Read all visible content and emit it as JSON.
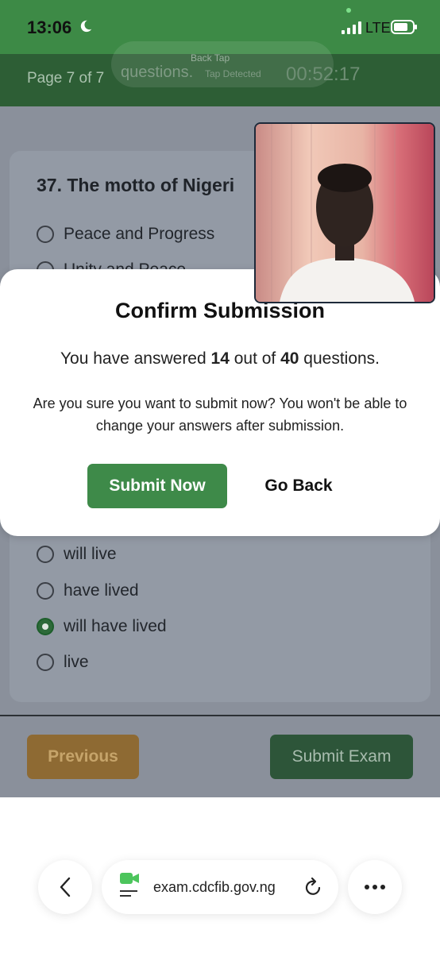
{
  "status_bar": {
    "time": "13:06",
    "network": "LTE"
  },
  "header": {
    "page_indicator": "Page 7 of 7",
    "timer": "00:52:17",
    "ghost_text": "questions.",
    "ghost_back_tap": "Back Tap",
    "ghost_sub": "Tap Detected"
  },
  "question": {
    "text": "37. The motto of Nigeri",
    "options_top": [
      "Peace and Progress",
      "Unity and Peace"
    ],
    "options_bottom": [
      {
        "label": "will live",
        "selected": false
      },
      {
        "label": "have lived",
        "selected": false
      },
      {
        "label": "will have lived",
        "selected": true
      },
      {
        "label": "live",
        "selected": false
      }
    ]
  },
  "footer": {
    "previous_label": "Previous",
    "submit_exam_label": "Submit Exam"
  },
  "modal": {
    "title": "Confirm Submission",
    "count_prefix": "You have answered ",
    "answered": "14",
    "count_middle": " out of ",
    "total": "40",
    "count_suffix": " questions.",
    "warning": "Are you sure you want to submit now? You won't be able to change your answers after submission.",
    "submit_label": "Submit Now",
    "back_label": "Go Back"
  },
  "browser": {
    "url": "exam.cdcfib.gov.ng"
  },
  "colors": {
    "primary_green": "#3e8a49",
    "header_green": "#3d8a46",
    "previous_brown": "#b07d33"
  },
  "icons": [
    "moon-icon",
    "signal-icon",
    "battery-icon",
    "chevron-left-icon",
    "facetime-icon",
    "reload-icon",
    "ellipsis-icon"
  ]
}
